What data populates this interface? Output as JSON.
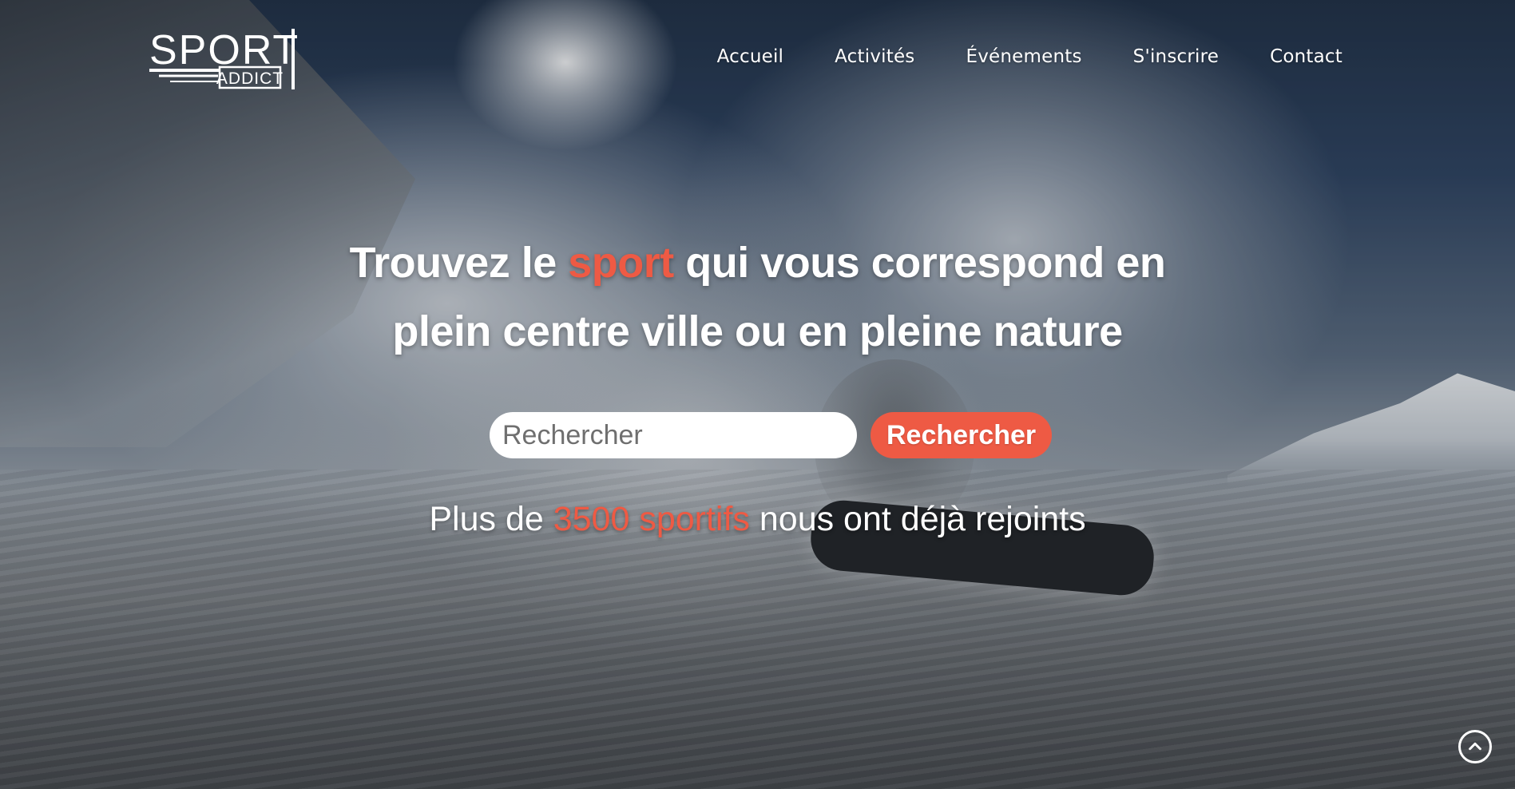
{
  "brand": {
    "logo_word": "SPORT",
    "logo_tag": "ADDICT"
  },
  "nav": {
    "items": [
      {
        "label": "Accueil"
      },
      {
        "label": "Activités"
      },
      {
        "label": "Événements"
      },
      {
        "label": "S'inscrire"
      },
      {
        "label": "Contact"
      }
    ]
  },
  "hero": {
    "headline_before": "Trouvez le ",
    "headline_accent": "sport",
    "headline_after_line1": " qui vous correspond en",
    "headline_line2": "plein centre ville ou en pleine nature",
    "search_placeholder": "Rechercher",
    "search_value": "",
    "search_button_label": "Rechercher",
    "stats_before": "Plus de ",
    "stats_accent": "3500 sportifs",
    "stats_after": " nous ont déjà rejoints"
  },
  "icons": {
    "scroll_top": "chevron-up-circle-icon"
  },
  "colors": {
    "accent": "#ee5a44",
    "text": "#ffffff"
  }
}
